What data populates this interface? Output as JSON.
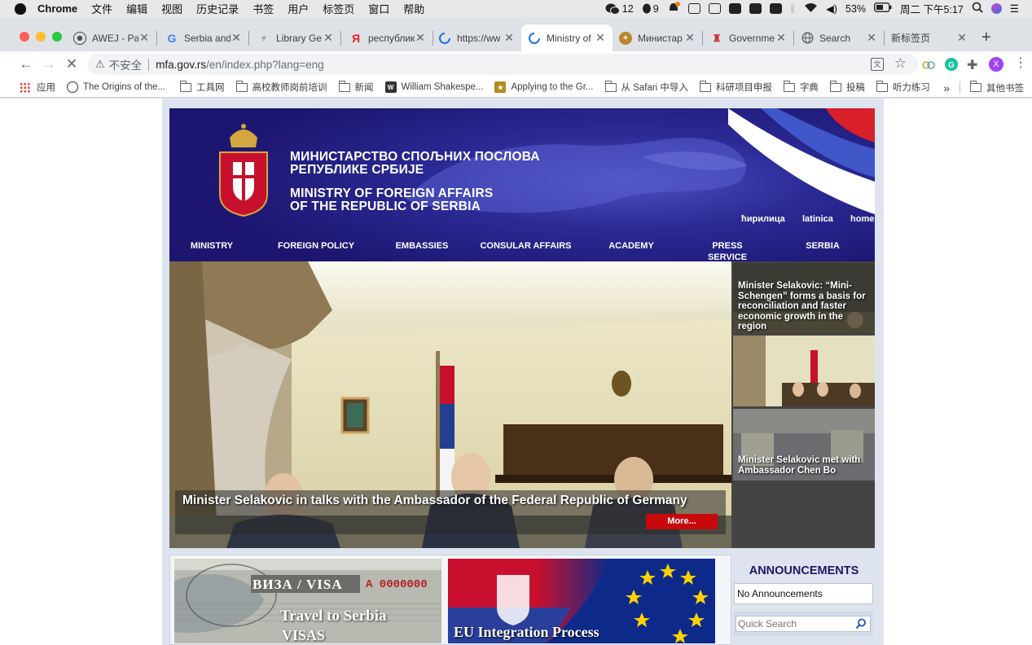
{
  "menubar": {
    "app": "Chrome",
    "items": [
      "文件",
      "编辑",
      "视图",
      "历史记录",
      "书签",
      "用户",
      "标签页",
      "窗口",
      "帮助"
    ],
    "wechat_count": "12",
    "qq_count": "9",
    "battery": "53%",
    "clock": "周二 下午5:17"
  },
  "tabs": [
    {
      "title": "AWEJ - Pa",
      "favicon": "awej-icon"
    },
    {
      "title": "Serbia and",
      "favicon": "google-icon"
    },
    {
      "title": "Library Ge",
      "favicon": "library-icon"
    },
    {
      "title": "республика",
      "favicon": "yandex-icon"
    },
    {
      "title": "https://ww",
      "favicon": "loading-icon"
    },
    {
      "title": "Ministry of",
      "favicon": "loading-icon"
    },
    {
      "title": "Министар",
      "favicon": "mfa-icon"
    },
    {
      "title": "Governme",
      "favicon": "gov-icon"
    },
    {
      "title": "Search",
      "favicon": "globe-icon"
    },
    {
      "title": "新标签页",
      "favicon": ""
    }
  ],
  "toolbar": {
    "insecure_label": "不安全",
    "url_host": "mfa.gov.rs",
    "url_path": "/en/index.php?lang=eng",
    "profile_initial": "X"
  },
  "bookmarks": {
    "items": [
      {
        "label": "应用",
        "type": "apps"
      },
      {
        "label": "The Origins of the...",
        "type": "site"
      },
      {
        "label": "工具网",
        "type": "folder"
      },
      {
        "label": "高校教师岗前培训",
        "type": "folder"
      },
      {
        "label": "新闻",
        "type": "folder"
      },
      {
        "label": "William Shakespe...",
        "type": "site"
      },
      {
        "label": "Applying to the Gr...",
        "type": "site"
      },
      {
        "label": "从 Safari 中导入",
        "type": "folder"
      },
      {
        "label": "科研项目申报",
        "type": "folder"
      },
      {
        "label": "字典",
        "type": "folder"
      },
      {
        "label": "投稿",
        "type": "folder"
      },
      {
        "label": "听力练习",
        "type": "folder"
      }
    ],
    "overflow": "»",
    "other": "其他书签"
  },
  "site": {
    "title_sr_1": "МИНИСТАРСТВО СПОЉНИХ ПОСЛОВА",
    "title_sr_2": "РЕПУБЛИКЕ СРБИЈЕ",
    "title_en_1": "MINISTRY OF FOREIGN AFFAIRS",
    "title_en_2": "OF THE REPUBLIC OF SERBIA",
    "lang_links": [
      "ћирилица",
      "latinica",
      "home"
    ],
    "nav": [
      "MINISTRY",
      "FOREIGN POLICY",
      "EMBASSIES",
      "CONSULAR AFFAIRS",
      "ACADEMY",
      "PRESS SERVICE",
      "SERBIA"
    ],
    "hero_caption": "Minister Selakovic in talks with the Ambassador of the Federal Republic of Germany",
    "more_button": "More...",
    "news": [
      {
        "title": "Minister Selakovic: “Mini-Schengen” forms a basis for reconciliation and faster economic growth in the region"
      },
      {
        "title": ""
      },
      {
        "title": "Minister Selakovic met with Ambassador Chen Bo"
      }
    ],
    "visa_banner_top": "ВИЗА / VISA",
    "visa_number": "A 0000000",
    "visa_banner_title_1": "Travel to Serbia",
    "visa_banner_title_2": "VISAS",
    "eu_banner_title": "EU Integration Process",
    "announcements_title": "ANNOUNCEMENTS",
    "announcements_empty": "No Announcements",
    "quick_search_placeholder": "Quick Search"
  },
  "colors": {
    "banner_blue": "#2b2a95",
    "nav_blue": "#1c1670",
    "more_red": "#c8080a",
    "announce_title": "#1b1766"
  }
}
